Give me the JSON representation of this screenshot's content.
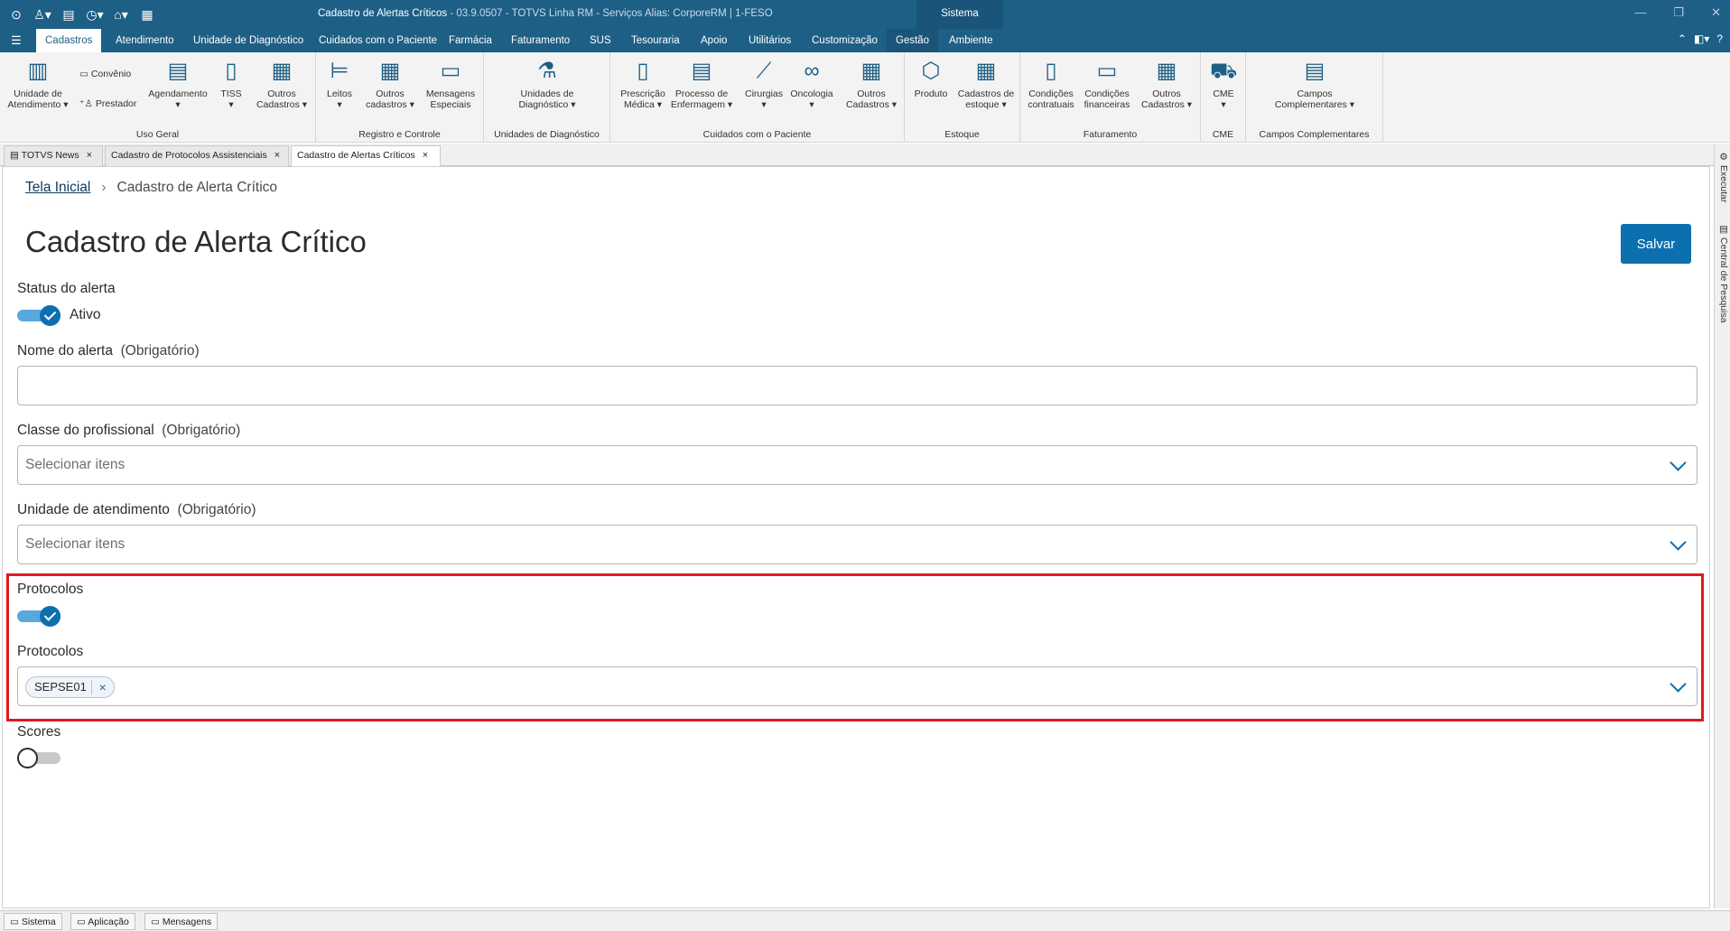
{
  "window": {
    "title": "Cadastro de Alertas Críticos",
    "subtitle": " - 03.9.0507 - TOTVS Linha RM - Serviços  Alias: CorporeRM | 1-FESO",
    "system_tab": "Sistema"
  },
  "menu": {
    "items": [
      "Cadastros",
      "Atendimento",
      "Unidade de Diagnóstico",
      "Cuidados com o Paciente",
      "Farmácia",
      "Faturamento",
      "SUS",
      "Tesouraria",
      "Apoio",
      "Utilitários",
      "Customização",
      "Gestão",
      "Ambiente"
    ]
  },
  "ribbon": {
    "uso_geral": {
      "label": "Uso Geral",
      "unidade": "Unidade de Atendimento",
      "convenio": "Convênio",
      "prestador": "Prestador",
      "agendamento": "Agendamento",
      "tiss": "TISS",
      "outros": "Outros Cadastros"
    },
    "registro": {
      "label": "Registro e Controle",
      "leitos": "Leitos",
      "outros": "Outros cadastros",
      "mensagens": "Mensagens Especiais"
    },
    "diagnostico": {
      "label": "Unidades de Diagnóstico",
      "unidades": "Unidades de Diagnóstico"
    },
    "cuidados": {
      "label": "Cuidados com o Paciente",
      "prescricao": "Prescrição Médica",
      "processo": "Processo de Enfermagem",
      "cirurgias": "Cirurgias",
      "oncologia": "Oncologia",
      "outros": "Outros Cadastros"
    },
    "estoque": {
      "label": "Estoque",
      "produto": "Produto",
      "cadastros": "Cadastros de estoque"
    },
    "faturamento": {
      "label": "Faturamento",
      "contratuais": "Condições contratuais",
      "financeiras": "Condições financeiras",
      "outros": "Outros Cadastros"
    },
    "cme": {
      "label": "CME",
      "cme": "CME"
    },
    "campos": {
      "label": "Campos Complementares",
      "campos": "Campos Complementares"
    }
  },
  "doc_tabs": [
    "TOTVS News",
    "Cadastro de Protocolos Assistenciais",
    "Cadastro de Alertas Críticos"
  ],
  "side_tabs": [
    "Executar",
    "Central de Pesquisa"
  ],
  "breadcrumb": {
    "home": "Tela Inicial",
    "current": "Cadastro de Alerta Crítico"
  },
  "page": {
    "title": "Cadastro de Alerta Crítico",
    "save": "Salvar"
  },
  "form": {
    "status": {
      "label": "Status do alerta",
      "value": "Ativo",
      "on": true
    },
    "nome": {
      "label": "Nome do alerta",
      "required": "(Obrigatório)",
      "value": ""
    },
    "classe": {
      "label": "Classe do profissional",
      "required": "(Obrigatório)",
      "placeholder": "Selecionar itens"
    },
    "unidade": {
      "label": "Unidade de atendimento",
      "required": "(Obrigatório)",
      "placeholder": "Selecionar itens"
    },
    "protocolos_toggle": {
      "label": "Protocolos",
      "on": true
    },
    "protocolos": {
      "label": "Protocolos",
      "selected": [
        "SEPSE01"
      ]
    },
    "scores": {
      "label": "Scores",
      "on": false
    }
  },
  "statusbar": [
    "Sistema",
    "Aplicação",
    "Mensagens"
  ],
  "colors": {
    "brand": "#1e5f85",
    "primary": "#0c6fae",
    "highlight": "#e0181f"
  }
}
